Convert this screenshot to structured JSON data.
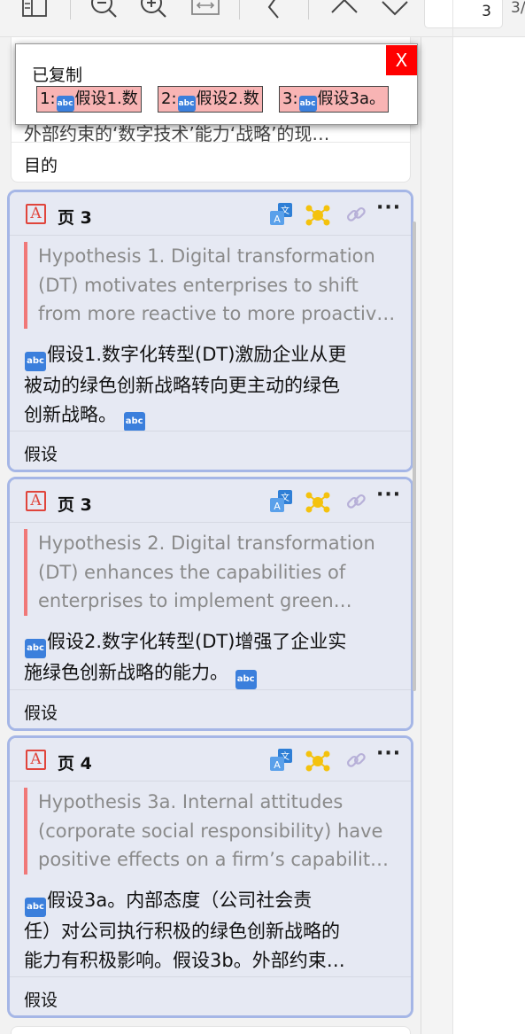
{
  "toolbar": {
    "page_current": "3",
    "page_total": "3/",
    "icons": [
      "sidebar-toggle-icon",
      "zoom-out-icon",
      "zoom-in-icon",
      "fit-width-icon",
      "back-icon",
      "page-up-icon",
      "page-down-icon"
    ]
  },
  "popup": {
    "title": "已复制",
    "close_label": "X",
    "chips": [
      {
        "num": "1:",
        "text": "假设1.数"
      },
      {
        "num": "2:",
        "text": "假设2.数"
      },
      {
        "num": "3:",
        "text": "假设3a。"
      }
    ]
  },
  "previous_card": {
    "text": "外部约束的‘数字技术’能力‘战略’的现…",
    "tag": "目的"
  },
  "cards": [
    {
      "page": "页 3",
      "quote": [
        "Hypothesis 1. Digital transformation",
        "(DT) motivates enterprises to shift",
        "from more reactive to more proactiv…"
      ],
      "translation": [
        "假设1.数字化转型(DT)激励企业从更",
        "被动的绿色创新战略转向更主动的绿色",
        "创新战略。"
      ],
      "tag": "假设"
    },
    {
      "page": "页 3",
      "quote": [
        "Hypothesis 2. Digital transformation",
        "(DT) enhances the capabilities of",
        "enterprises to implement green…"
      ],
      "translation": [
        "假设2.数字化转型(DT)增强了企业实",
        "施绿色创新战略的能力。"
      ],
      "tag": "假设"
    },
    {
      "page": "页 4",
      "quote": [
        "Hypothesis 3a. Internal attitudes",
        "(corporate social responsibility) have",
        "positive effects on a firm’s capability…"
      ],
      "translation": [
        "假设3a。内部态度（公司社会责",
        "任）对公司执行积极的绿色创新战略的",
        "能力有积极影响。假设3b。外部约束…"
      ],
      "tag": "假设"
    }
  ],
  "colors": {
    "card_border": "#a5b6e6",
    "card_bg": "#e6e9f3",
    "quote_bar": "#f07878",
    "pdf_icon": "#e0443b",
    "popup_close": "#ff0000",
    "chip_bg": "#f8b4b4",
    "abc_badge": "#3b7fdc"
  }
}
